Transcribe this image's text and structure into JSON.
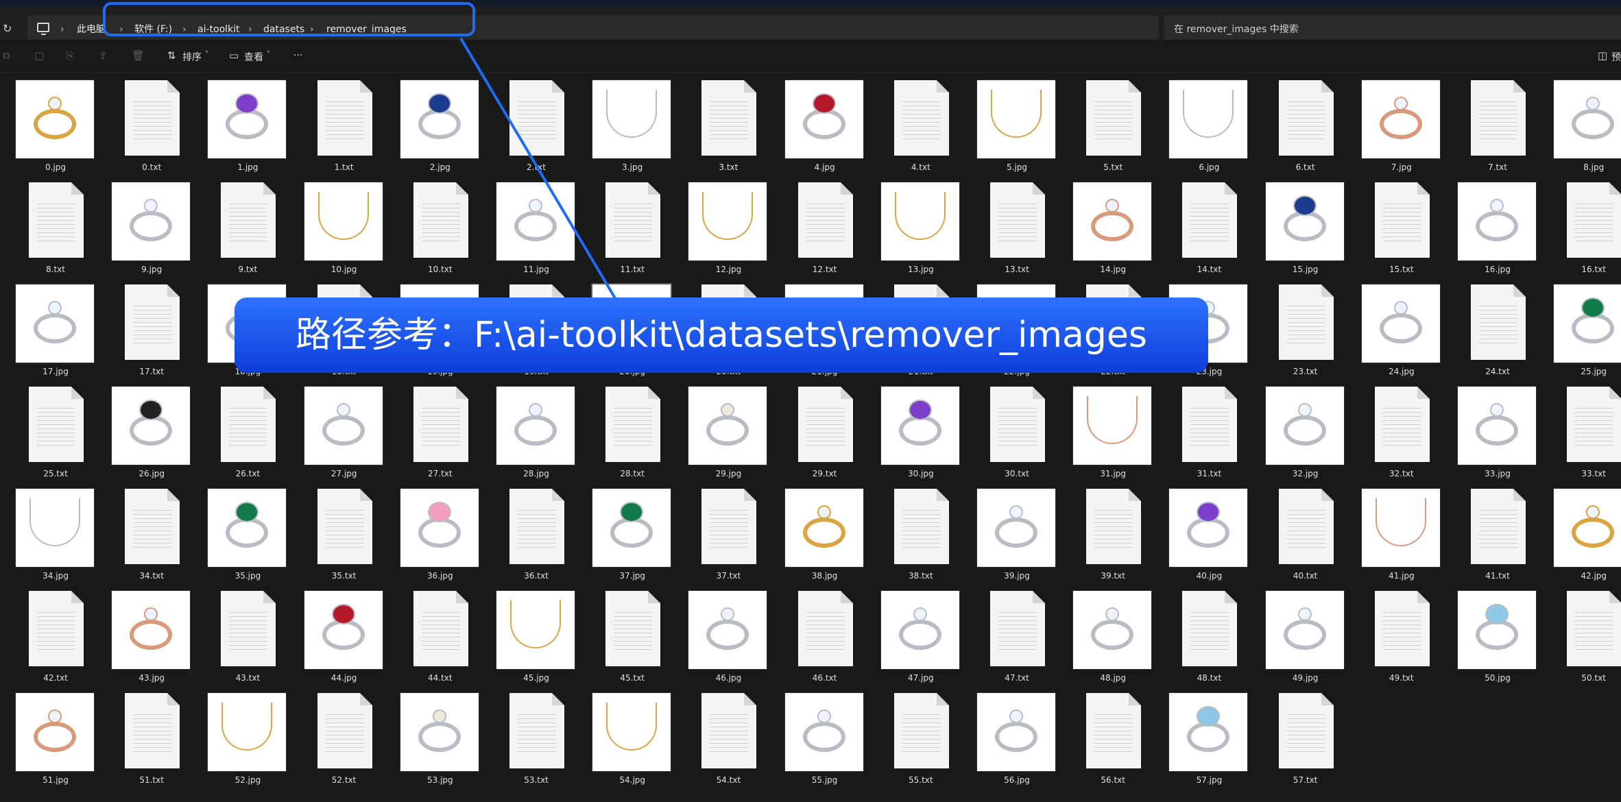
{
  "breadcrumb": [
    "此电脑",
    "软件 (F:)",
    "ai-toolkit",
    "datasets",
    "remover_images"
  ],
  "search": {
    "placeholder": "在 remover_images 中搜索"
  },
  "toolbar": {
    "sort_label": "排序",
    "view_label": "查看",
    "more_label": "···",
    "right_label": "预"
  },
  "annotation": {
    "text": "路径参考：F:\\ai-toolkit\\datasets\\remover_images"
  },
  "files": [
    {
      "name": "0.jpg",
      "type": "jpg",
      "kind": "ring-gold"
    },
    {
      "name": "0.txt",
      "type": "txt"
    },
    {
      "name": "1.jpg",
      "type": "jpg",
      "kind": "ring-amethyst"
    },
    {
      "name": "1.txt",
      "type": "txt"
    },
    {
      "name": "2.jpg",
      "type": "jpg",
      "kind": "ring-sapphire"
    },
    {
      "name": "2.txt",
      "type": "txt"
    },
    {
      "name": "3.jpg",
      "type": "jpg",
      "kind": "chain-silver"
    },
    {
      "name": "3.txt",
      "type": "txt"
    },
    {
      "name": "4.jpg",
      "type": "jpg",
      "kind": "ring-ruby"
    },
    {
      "name": "4.txt",
      "type": "txt"
    },
    {
      "name": "5.jpg",
      "type": "jpg",
      "kind": "chain-gold"
    },
    {
      "name": "5.txt",
      "type": "txt"
    },
    {
      "name": "6.jpg",
      "type": "jpg",
      "kind": "chain-silver"
    },
    {
      "name": "6.txt",
      "type": "txt"
    },
    {
      "name": "7.jpg",
      "type": "jpg",
      "kind": "ring-rose"
    },
    {
      "name": "7.txt",
      "type": "txt"
    },
    {
      "name": "8.jpg",
      "type": "jpg",
      "kind": "ring-silver"
    },
    {
      "name": "8.txt",
      "type": "txt"
    },
    {
      "name": "9.jpg",
      "type": "jpg",
      "kind": "ring-silver"
    },
    {
      "name": "9.txt",
      "type": "txt"
    },
    {
      "name": "10.jpg",
      "type": "jpg",
      "kind": "chain-gold"
    },
    {
      "name": "10.txt",
      "type": "txt"
    },
    {
      "name": "11.jpg",
      "type": "jpg",
      "kind": "ring-silver"
    },
    {
      "name": "11.txt",
      "type": "txt"
    },
    {
      "name": "12.jpg",
      "type": "jpg",
      "kind": "chain-gold"
    },
    {
      "name": "12.txt",
      "type": "txt"
    },
    {
      "name": "13.jpg",
      "type": "jpg",
      "kind": "chain-gold"
    },
    {
      "name": "13.txt",
      "type": "txt"
    },
    {
      "name": "14.jpg",
      "type": "jpg",
      "kind": "ring-rose"
    },
    {
      "name": "14.txt",
      "type": "txt"
    },
    {
      "name": "15.jpg",
      "type": "jpg",
      "kind": "ring-sapphire"
    },
    {
      "name": "15.txt",
      "type": "txt"
    },
    {
      "name": "16.jpg",
      "type": "jpg",
      "kind": "ring-silver"
    },
    {
      "name": "16.txt",
      "type": "txt"
    },
    {
      "name": "17.jpg",
      "type": "jpg",
      "kind": "ring-silver"
    },
    {
      "name": "17.txt",
      "type": "txt"
    },
    {
      "name": "18.jpg",
      "type": "jpg",
      "kind": "ring-silver"
    },
    {
      "name": "18.txt",
      "type": "txt"
    },
    {
      "name": "19.jpg",
      "type": "jpg",
      "kind": "ring-silver"
    },
    {
      "name": "19.txt",
      "type": "txt"
    },
    {
      "name": "20.jpg",
      "type": "jpg",
      "kind": "ring-silver"
    },
    {
      "name": "20.txt",
      "type": "txt"
    },
    {
      "name": "21.jpg",
      "type": "jpg",
      "kind": "ring-silver"
    },
    {
      "name": "21.txt",
      "type": "txt"
    },
    {
      "name": "22.jpg",
      "type": "jpg",
      "kind": "ring-silver"
    },
    {
      "name": "22.txt",
      "type": "txt"
    },
    {
      "name": "23.jpg",
      "type": "jpg",
      "kind": "ring-silver"
    },
    {
      "name": "23.txt",
      "type": "txt"
    },
    {
      "name": "24.jpg",
      "type": "jpg",
      "kind": "ring-silver"
    },
    {
      "name": "24.txt",
      "type": "txt"
    },
    {
      "name": "25.jpg",
      "type": "jpg",
      "kind": "ring-emerald"
    },
    {
      "name": "25.txt",
      "type": "txt"
    },
    {
      "name": "26.jpg",
      "type": "jpg",
      "kind": "ring-black"
    },
    {
      "name": "26.txt",
      "type": "txt"
    },
    {
      "name": "27.jpg",
      "type": "jpg",
      "kind": "ring-silver"
    },
    {
      "name": "27.txt",
      "type": "txt"
    },
    {
      "name": "28.jpg",
      "type": "jpg",
      "kind": "ring-silver"
    },
    {
      "name": "28.txt",
      "type": "txt"
    },
    {
      "name": "29.jpg",
      "type": "jpg",
      "kind": "ring-pearl"
    },
    {
      "name": "29.txt",
      "type": "txt"
    },
    {
      "name": "30.jpg",
      "type": "jpg",
      "kind": "ring-amethyst"
    },
    {
      "name": "30.txt",
      "type": "txt"
    },
    {
      "name": "31.jpg",
      "type": "jpg",
      "kind": "chain-rose"
    },
    {
      "name": "31.txt",
      "type": "txt"
    },
    {
      "name": "32.jpg",
      "type": "jpg",
      "kind": "ring-silver"
    },
    {
      "name": "32.txt",
      "type": "txt"
    },
    {
      "name": "33.jpg",
      "type": "jpg",
      "kind": "ring-silver"
    },
    {
      "name": "33.txt",
      "type": "txt"
    },
    {
      "name": "34.jpg",
      "type": "jpg",
      "kind": "chain-silver"
    },
    {
      "name": "34.txt",
      "type": "txt"
    },
    {
      "name": "35.jpg",
      "type": "jpg",
      "kind": "earring-emerald"
    },
    {
      "name": "35.txt",
      "type": "txt"
    },
    {
      "name": "36.jpg",
      "type": "jpg",
      "kind": "ring-pink"
    },
    {
      "name": "36.txt",
      "type": "txt"
    },
    {
      "name": "37.jpg",
      "type": "jpg",
      "kind": "ring-emerald"
    },
    {
      "name": "37.txt",
      "type": "txt"
    },
    {
      "name": "38.jpg",
      "type": "jpg",
      "kind": "ring-gold"
    },
    {
      "name": "38.txt",
      "type": "txt"
    },
    {
      "name": "39.jpg",
      "type": "jpg",
      "kind": "earring-silver"
    },
    {
      "name": "39.txt",
      "type": "txt"
    },
    {
      "name": "40.jpg",
      "type": "jpg",
      "kind": "ring-amethyst"
    },
    {
      "name": "40.txt",
      "type": "txt"
    },
    {
      "name": "41.jpg",
      "type": "jpg",
      "kind": "chain-rose"
    },
    {
      "name": "41.txt",
      "type": "txt"
    },
    {
      "name": "42.jpg",
      "type": "jpg",
      "kind": "ring-gold"
    },
    {
      "name": "42.txt",
      "type": "txt"
    },
    {
      "name": "43.jpg",
      "type": "jpg",
      "kind": "ring-rose"
    },
    {
      "name": "43.txt",
      "type": "txt"
    },
    {
      "name": "44.jpg",
      "type": "jpg",
      "kind": "ring-ruby"
    },
    {
      "name": "44.txt",
      "type": "txt"
    },
    {
      "name": "45.jpg",
      "type": "jpg",
      "kind": "chain-gold"
    },
    {
      "name": "45.txt",
      "type": "txt"
    },
    {
      "name": "46.jpg",
      "type": "jpg",
      "kind": "ring-silver"
    },
    {
      "name": "46.txt",
      "type": "txt"
    },
    {
      "name": "47.jpg",
      "type": "jpg",
      "kind": "ring-silver"
    },
    {
      "name": "47.txt",
      "type": "txt"
    },
    {
      "name": "48.jpg",
      "type": "jpg",
      "kind": "ring-silver"
    },
    {
      "name": "48.txt",
      "type": "txt"
    },
    {
      "name": "49.jpg",
      "type": "jpg",
      "kind": "ring-silver"
    },
    {
      "name": "49.txt",
      "type": "txt"
    },
    {
      "name": "50.jpg",
      "type": "jpg",
      "kind": "ring-aqua"
    },
    {
      "name": "50.txt",
      "type": "txt"
    },
    {
      "name": "51.jpg",
      "type": "jpg",
      "kind": "ring-rose"
    },
    {
      "name": "51.txt",
      "type": "txt"
    },
    {
      "name": "52.jpg",
      "type": "jpg",
      "kind": "chain-gold"
    },
    {
      "name": "52.txt",
      "type": "txt"
    },
    {
      "name": "53.jpg",
      "type": "jpg",
      "kind": "ring-pearl"
    },
    {
      "name": "53.txt",
      "type": "txt"
    },
    {
      "name": "54.jpg",
      "type": "jpg",
      "kind": "chain-gold"
    },
    {
      "name": "54.txt",
      "type": "txt"
    },
    {
      "name": "55.jpg",
      "type": "jpg",
      "kind": "ring-silver"
    },
    {
      "name": "55.txt",
      "type": "txt"
    },
    {
      "name": "56.jpg",
      "type": "jpg",
      "kind": "ring-silver"
    },
    {
      "name": "56.txt",
      "type": "txt"
    },
    {
      "name": "57.jpg",
      "type": "jpg",
      "kind": "ring-aqua"
    },
    {
      "name": "57.txt",
      "type": "txt"
    }
  ],
  "colors": {
    "background": "#191919",
    "highlight": "#1e6cf5",
    "banner_top": "#2f72ff",
    "banner_bottom": "#0d3ed8",
    "silver": "#b9bcc2",
    "gold": "#d9a441",
    "rose": "#d99a7c",
    "amethyst": "#7d3fc9",
    "sapphire": "#1c3d8f",
    "ruby": "#b3192b",
    "emerald": "#137a4a",
    "black": "#222222",
    "pearl": "#efe9dc",
    "pink": "#f3a0c0",
    "aqua": "#8fc8e6"
  }
}
